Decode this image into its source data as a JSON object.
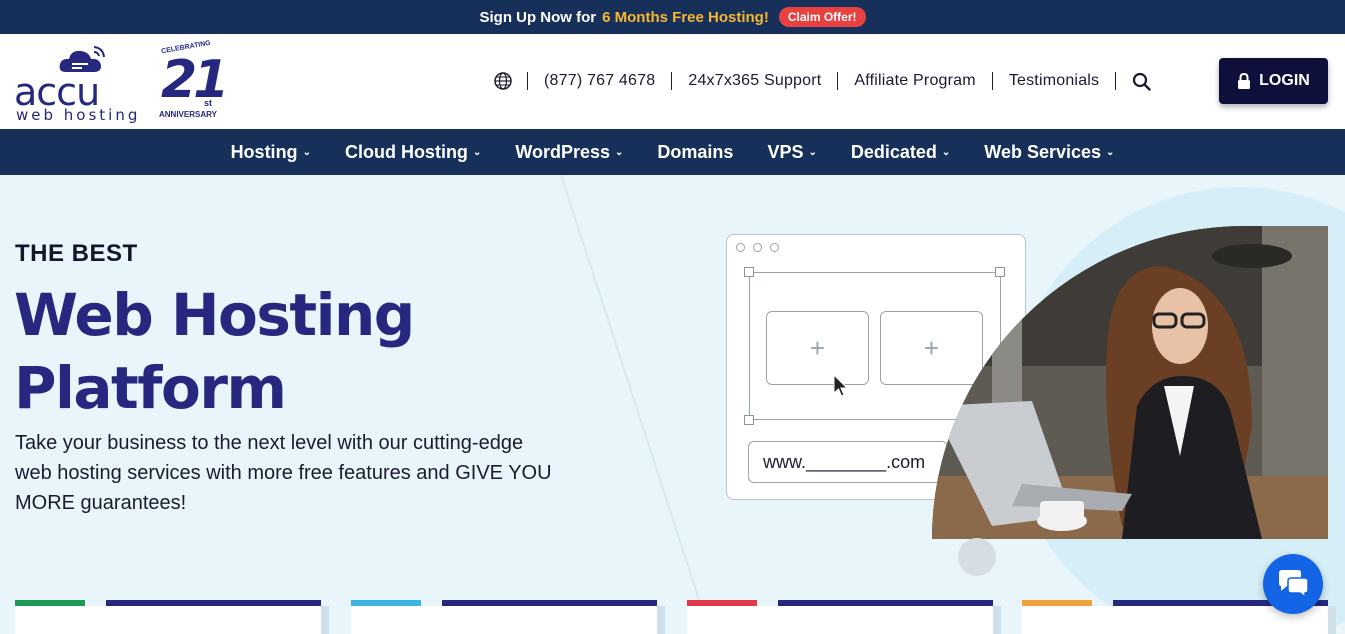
{
  "promo": {
    "text": "Sign Up Now for",
    "highlight": "6 Months Free Hosting!",
    "cta": "Claim Offer!"
  },
  "logo": {
    "wordmark": "accu",
    "subtitle": "web hosting",
    "badge_top": "CELEBRATING",
    "badge_number": "21",
    "badge_suffix": "st",
    "badge_bottom": "ANNIVERSARY"
  },
  "topnav": {
    "globe_icon": "globe-icon",
    "phone": "(877) 767 4678",
    "support": "24x7x365 Support",
    "affiliate": "Affiliate Program",
    "testimonials": "Testimonials",
    "search_icon": "search-icon",
    "login_label": "LOGIN"
  },
  "mainnav": {
    "items": [
      {
        "label": "Hosting",
        "dropdown": true
      },
      {
        "label": "Cloud Hosting",
        "dropdown": true
      },
      {
        "label": "WordPress",
        "dropdown": true
      },
      {
        "label": "Domains",
        "dropdown": false
      },
      {
        "label": "VPS",
        "dropdown": true
      },
      {
        "label": "Dedicated",
        "dropdown": true
      },
      {
        "label": "Web Services",
        "dropdown": true
      }
    ]
  },
  "hero": {
    "eyebrow": "THE BEST",
    "headline_line1": "Web Hosting",
    "headline_line2": "Platform",
    "description": "Take your business to the next level with our cutting-edge web hosting services with more free features and GIVE YOU MORE guarantees!",
    "mock_url": "www.________.com"
  },
  "cards": {
    "accent_colors": [
      "#1a9a55",
      "#3bb5e0",
      "#e0394a",
      "#f2a23a"
    ]
  },
  "colors": {
    "brand_navy": "#17305a",
    "brand_indigo": "#26287f",
    "promo_highlight": "#f7b731",
    "claim_red": "#e8413f",
    "chat_blue": "#1464e6"
  }
}
